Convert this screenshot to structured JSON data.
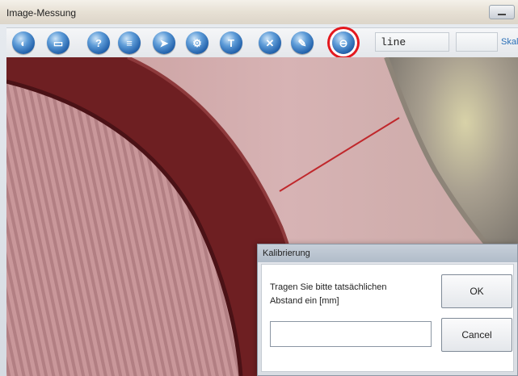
{
  "window": {
    "title": "Image-Messung"
  },
  "toolbar": {
    "buttons": [
      {
        "icon": "open-icon",
        "glyph": "◐"
      },
      {
        "icon": "save-icon",
        "glyph": "▭"
      },
      {
        "icon": "help-icon",
        "glyph": "?"
      },
      {
        "icon": "list-icon",
        "glyph": "≡"
      },
      {
        "icon": "send-icon",
        "glyph": "➤"
      },
      {
        "icon": "settings-icon",
        "glyph": "⚙"
      },
      {
        "icon": "text-icon",
        "glyph": "T"
      },
      {
        "icon": "close-icon",
        "glyph": "✕"
      },
      {
        "icon": "edit-icon",
        "glyph": "✎"
      },
      {
        "icon": "calibrate-icon",
        "glyph": "⊖",
        "active": true
      }
    ],
    "mode_value": "line",
    "scale_label": "Skal"
  },
  "dialog": {
    "title": "Kalibrierung",
    "prompt_line1": "Tragen Sie bitte tatsächlichen",
    "prompt_line2": "Abstand ein [mm]",
    "input_value": "",
    "ok_label": "OK",
    "cancel_label": "Cancel"
  },
  "colors": {
    "active_highlight": "#e3181e",
    "measure_line": "#c0282c"
  }
}
